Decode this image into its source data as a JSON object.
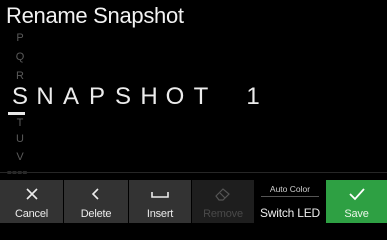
{
  "screen": {
    "title": "Rename Snapshot"
  },
  "picker": {
    "chars_above": [
      "P",
      "Q",
      "R"
    ],
    "chars_below": [
      "T",
      "U",
      "V"
    ]
  },
  "name": {
    "chars": [
      "S",
      "N",
      "A",
      "P",
      "S",
      "H",
      "O",
      "T",
      " ",
      "1"
    ]
  },
  "footer": {
    "section_label": "====",
    "buttons": [
      {
        "label": "Cancel",
        "icon": "close-icon"
      },
      {
        "label": "Delete",
        "icon": "chevron-left-icon"
      },
      {
        "label": "Insert",
        "icon": "space-icon"
      },
      {
        "label": "Remove",
        "icon": "eraser-icon"
      },
      {
        "top_label": "Auto Color",
        "label": "Switch LED"
      },
      {
        "label": "Save",
        "icon": "check-icon"
      }
    ]
  },
  "colors": {
    "background": "#000000",
    "button_bg": "#333333",
    "save_green": "#2ea043",
    "text": "#ececec"
  }
}
